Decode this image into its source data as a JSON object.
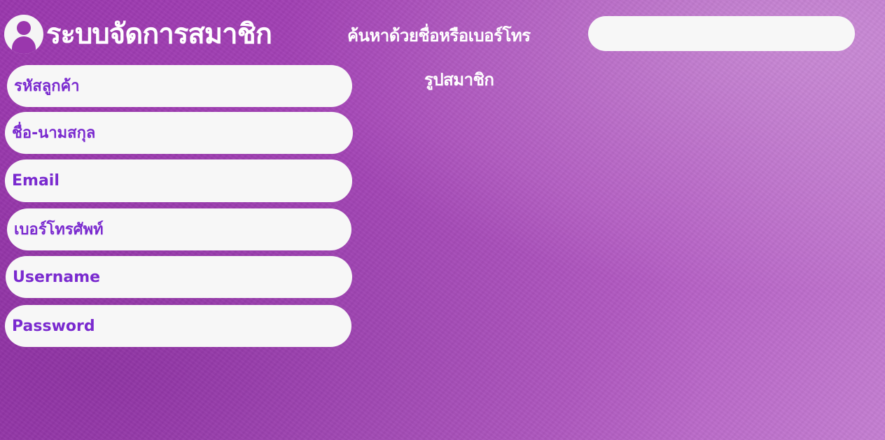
{
  "header": {
    "title": "ระบบจัดการสมาชิก",
    "avatar_icon": "user-avatar-icon"
  },
  "search": {
    "label": "ค้นหาด้วยชื่อหรือเบอร์โทร",
    "value": "",
    "placeholder": ""
  },
  "photo": {
    "label": "รูปสมาชิก"
  },
  "form": {
    "customer_id_placeholder": "รหัสลูกค้า",
    "fullname_placeholder": "ชื่อ-นามสกุล",
    "email_placeholder": "Email",
    "phone_placeholder": "เบอร์โทรศัพท์",
    "username_placeholder": "Username",
    "password_placeholder": "Password"
  },
  "colors": {
    "background": "#a443b6",
    "field_bg": "#f7f7f7",
    "field_text": "#7a2acf",
    "title_text": "#ffffff"
  }
}
